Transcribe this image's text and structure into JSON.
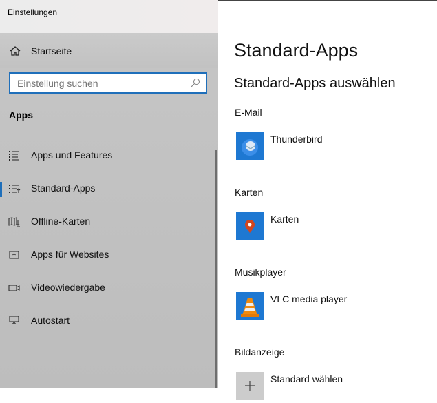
{
  "window": {
    "title": "Einstellungen"
  },
  "sidebar": {
    "home": "Startseite",
    "search": {
      "placeholder": "Einstellung suchen"
    },
    "section": "Apps",
    "items": [
      {
        "label": "Apps und Features",
        "icon": "list-icon"
      },
      {
        "label": "Standard-Apps",
        "icon": "default-apps-icon",
        "selected": true
      },
      {
        "label": "Offline-Karten",
        "icon": "map-download-icon"
      },
      {
        "label": "Apps für Websites",
        "icon": "open-app-icon"
      },
      {
        "label": "Videowiedergabe",
        "icon": "video-icon"
      },
      {
        "label": "Autostart",
        "icon": "startup-icon"
      }
    ]
  },
  "main": {
    "title": "Standard-Apps",
    "subtitle": "Standard-Apps auswählen",
    "categories": [
      {
        "label": "E-Mail",
        "app": "Thunderbird"
      },
      {
        "label": "Karten",
        "app": "Karten"
      },
      {
        "label": "Musikplayer",
        "app": "VLC media player"
      },
      {
        "label": "Bildanzeige",
        "app": "Standard wählen"
      }
    ]
  },
  "colors": {
    "accent": "#1f6fba",
    "tile": "#1e78d2"
  }
}
